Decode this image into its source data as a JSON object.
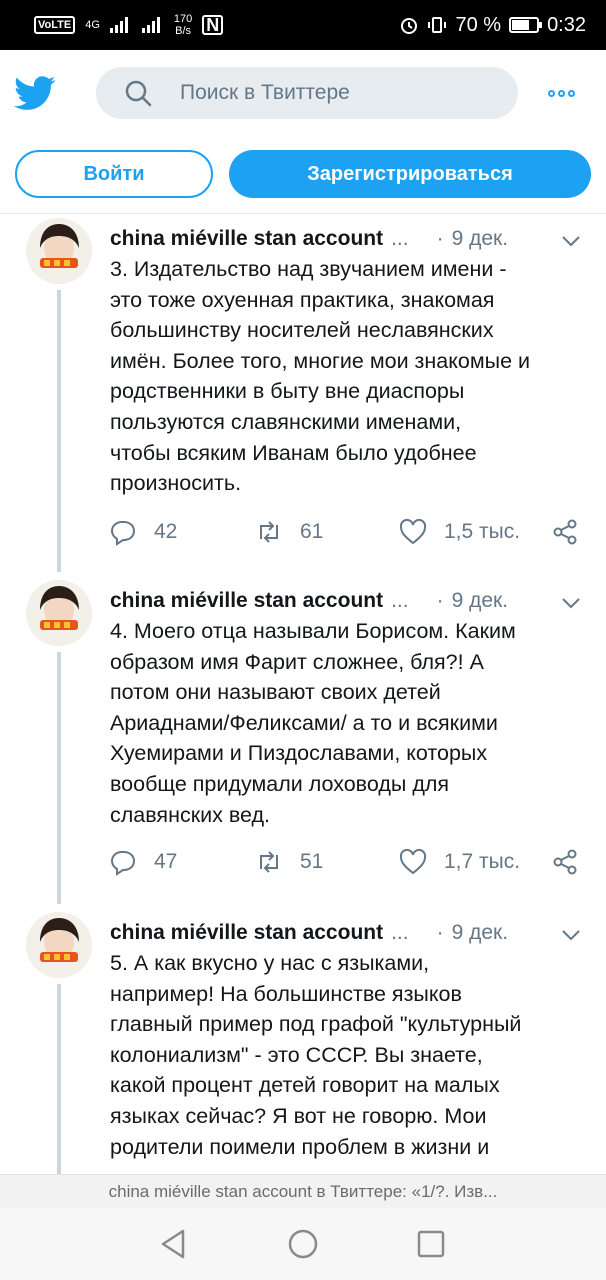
{
  "status_bar": {
    "volte": "VoLTE",
    "network": "4G",
    "speed_value": "170",
    "speed_unit": "B/s",
    "battery_percent": "70 %",
    "battery_level": 0.7,
    "time": "0:32"
  },
  "header": {
    "search_placeholder": "Поиск в Твиттере"
  },
  "auth": {
    "login_label": "Войти",
    "signup_label": "Зарегистрироваться"
  },
  "colors": {
    "accent": "#1da1f2",
    "secondary_text": "#657786",
    "thread_line": "#ccd6dd"
  },
  "tweets": [
    {
      "author": "china miéville stan account",
      "ellipsis": "...",
      "separator": "·",
      "date": "9 дек.",
      "lines": [
        "3. Издательство над звучанием имени -",
        "это тоже охуенная практика, знакомая",
        "большинству носителей неславянских",
        "имён. Более того, многие мои знакомые и",
        "родственники в быту вне диаспоры",
        "пользуются славянскими именами,",
        "чтобы всяким Иванам было удобнее",
        "произносить."
      ],
      "replies": "42",
      "retweets": "61",
      "likes": "1,5 тыс."
    },
    {
      "author": "china miéville stan account",
      "ellipsis": "...",
      "separator": "·",
      "date": "9 дек.",
      "lines": [
        "4. Моего отца называли Борисом. Каким",
        "образом имя Фарит сложнее, бля?! А",
        "потом они называют своих детей",
        "Ариаднами/Феликсами/ а то и всякими",
        "Хуемирами и Пиздославами, которых",
        "вообще придумали лоховоды для",
        "славянских вед."
      ],
      "replies": "47",
      "retweets": "51",
      "likes": "1,7 тыс."
    },
    {
      "author": "china miéville stan account",
      "ellipsis": "...",
      "separator": "·",
      "date": "9 дек.",
      "lines": [
        "5. А как вкусно у нас с языками,",
        "например! На большинстве языков",
        "главный пример под графой \"культурный",
        "колониализм\" - это СССР. Вы знаете,",
        "какой процент детей говорит на малых",
        "языках сейчас? Я вот не говорю. Мои",
        "родители поимели проблем в жизни и"
      ]
    }
  ],
  "page_title_bar": "china miéville stan account в Твиттере: «1/?. Изв..."
}
